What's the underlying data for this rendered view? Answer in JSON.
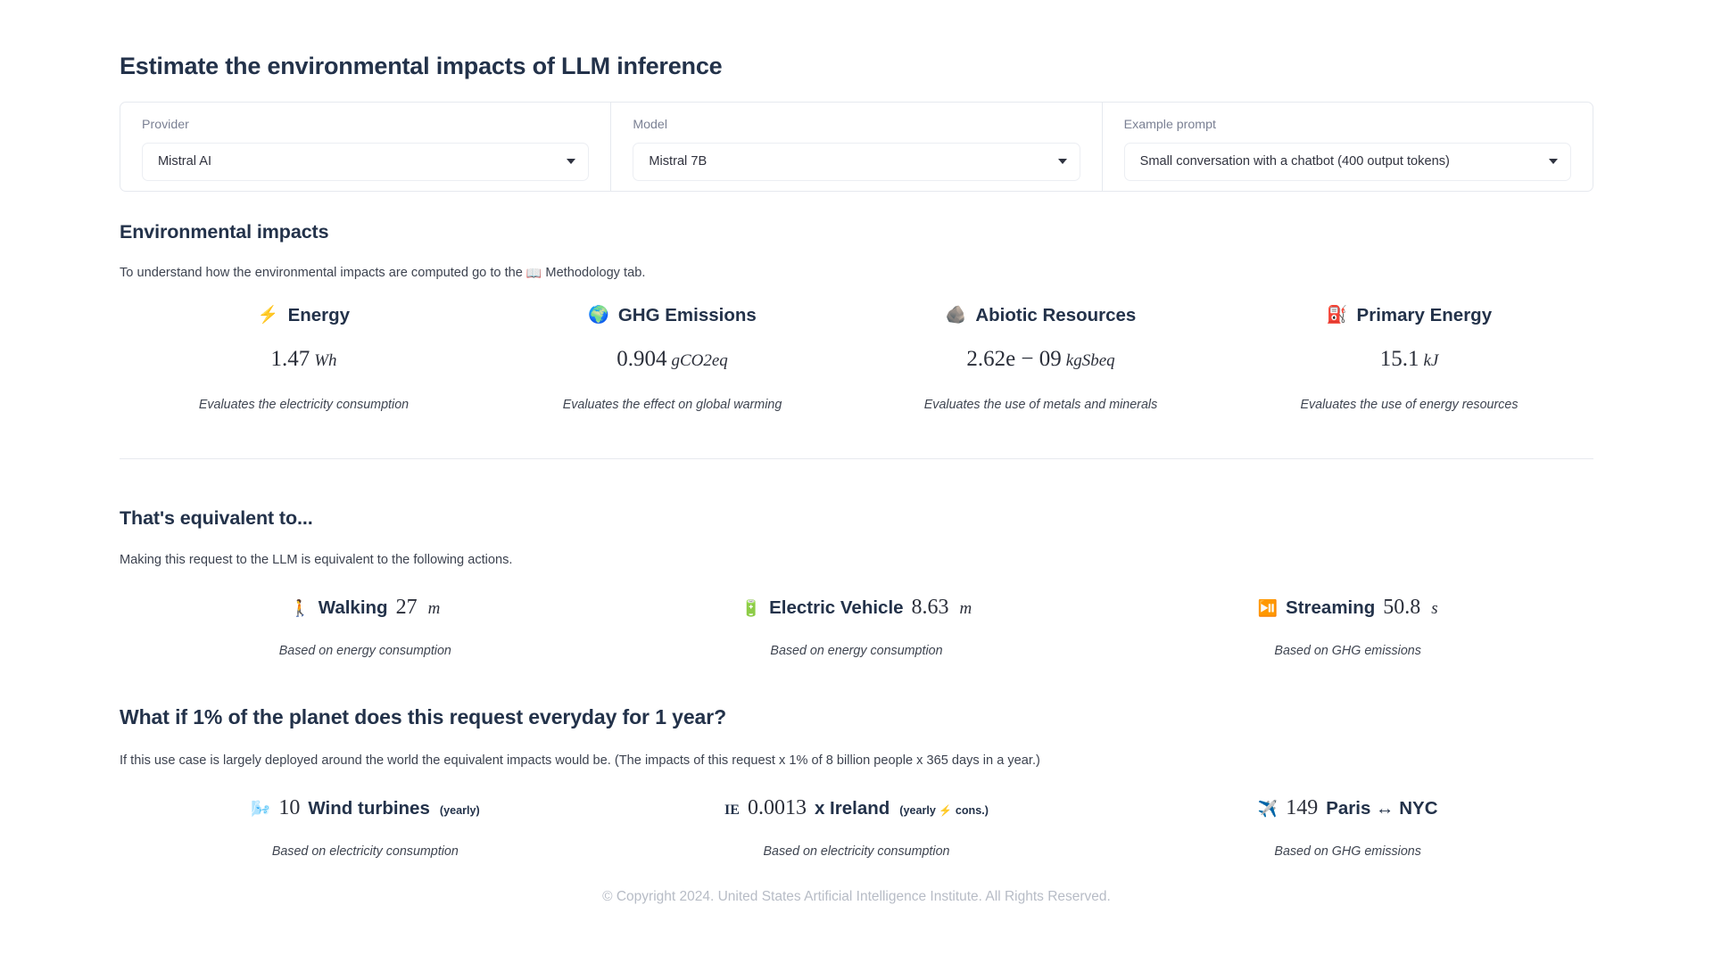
{
  "page": {
    "title": "Estimate the environmental impacts of LLM inference"
  },
  "selectors": [
    {
      "label": "Provider",
      "value": "Mistral AI",
      "icon": "chevron-down-icon"
    },
    {
      "label": "Model",
      "value": "Mistral 7B",
      "icon": "chevron-down-icon"
    },
    {
      "label": "Example prompt",
      "value": "Small conversation with a chatbot (400 output tokens)",
      "icon": "chevron-down-icon"
    }
  ],
  "impacts": {
    "heading": "Environmental impacts",
    "subtitle_before": "To understand how the environmental impacts are computed go to the ",
    "subtitle_icon": "📖",
    "subtitle_after": " Methodology tab.",
    "cards": [
      {
        "emoji": "⚡",
        "icon_name": "lightning-bolt-icon",
        "title": "Energy",
        "value": "1.47",
        "unit": "Wh",
        "description": "Evaluates the electricity consumption"
      },
      {
        "emoji": "🌍",
        "icon_name": "earth-globe-icon",
        "title": "GHG Emissions",
        "value": "0.904",
        "unit": "gCO2eq",
        "description": "Evaluates the effect on global warming"
      },
      {
        "emoji": "🪨",
        "icon_name": "rock-icon",
        "title": "Abiotic Resources",
        "value": "2.62e − 09",
        "unit": "kgSbeq",
        "description": "Evaluates the use of metals and minerals"
      },
      {
        "emoji": "⛽",
        "icon_name": "fuel-pump-icon",
        "title": "Primary Energy",
        "value": "15.1",
        "unit": "kJ",
        "description": "Evaluates the use of energy resources"
      }
    ]
  },
  "equivalent": {
    "heading": "That's equivalent to...",
    "subtitle": "Making this request to the LLM is equivalent to the following actions.",
    "cards": [
      {
        "emoji": "🚶",
        "icon_name": "walking-person-icon",
        "title": "Walking",
        "value": "27",
        "unit": "m",
        "description": "Based on energy consumption"
      },
      {
        "emoji": "🔋",
        "icon_name": "battery-icon",
        "title": "Electric Vehicle",
        "value": "8.63",
        "unit": "m",
        "description": "Based on energy consumption"
      },
      {
        "emoji": "⏯️",
        "icon_name": "play-pause-icon",
        "title": "Streaming",
        "value": "50.8",
        "unit": "s",
        "description": "Based on GHG emissions"
      }
    ]
  },
  "planet": {
    "heading": "What if 1% of the planet does this request everyday for 1 year?",
    "subtitle": "If this use case is largely deployed around the world the equivalent impacts would be. (The impacts of this request x 1% of 8 billion people x 365 days in a year.)",
    "cards": [
      {
        "emoji": "🌬️",
        "icon_name": "wind-turbine-icon",
        "value": "10",
        "title": "Wind turbines",
        "suffix": "(yearly)",
        "description": "Based on electricity consumption"
      },
      {
        "emoji": "IE",
        "icon_name": "ireland-flag-icon",
        "value": "0.0013",
        "title": "x Ireland",
        "suffix_pre": "(yearly ",
        "suffix_bolt": "⚡",
        "suffix_post": " cons.)",
        "description": "Based on electricity consumption"
      },
      {
        "emoji": "✈️",
        "icon_name": "airplane-icon",
        "value": "149",
        "title": "Paris ↔ NYC",
        "suffix": "",
        "description": "Based on GHG emissions"
      }
    ]
  },
  "footer": {
    "text": "© Copyright 2024. United States Artificial Intelligence Institute. All Rights Reserved."
  }
}
